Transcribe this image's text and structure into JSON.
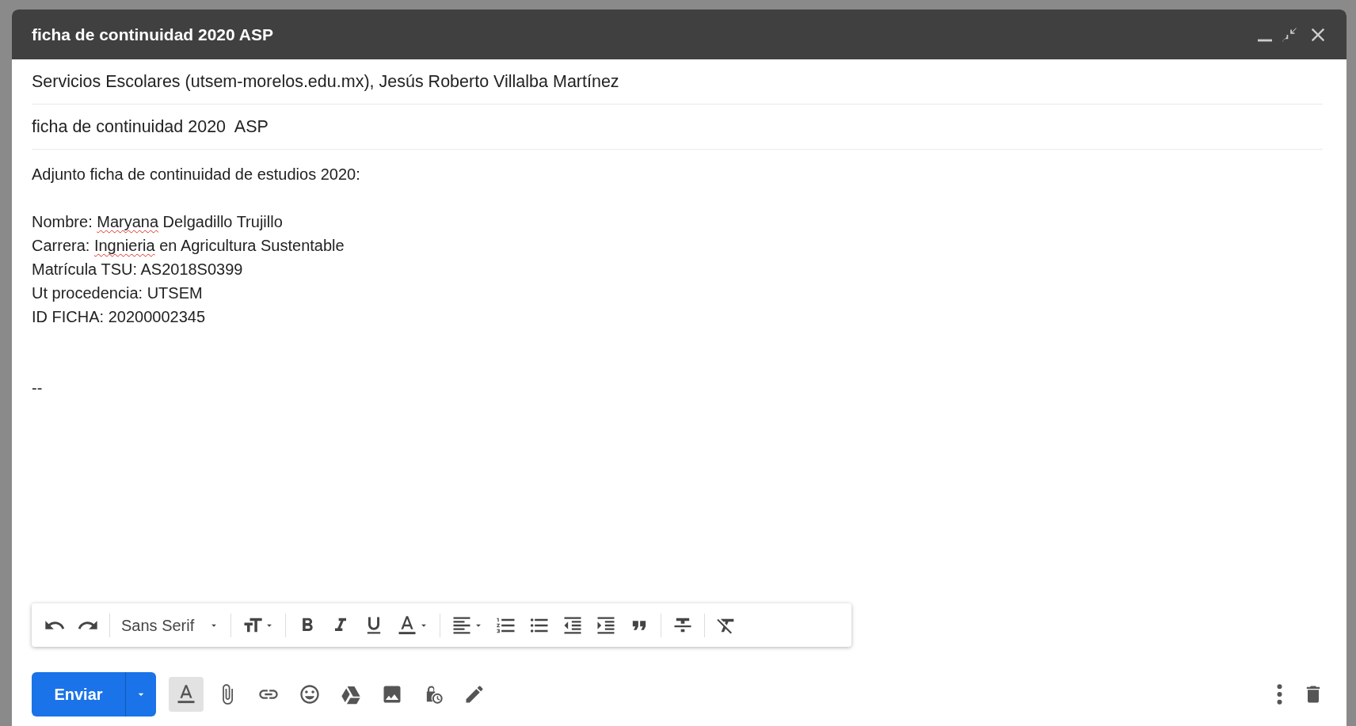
{
  "window": {
    "title": "ficha de continuidad 2020 ASP"
  },
  "recipients": "Servicios Escolares (utsem-morelos.edu.mx), Jesús Roberto Villalba Martínez",
  "subject": "ficha de continuidad 2020  ASP",
  "body": [
    {
      "kind": "text",
      "lines": [
        {
          "segments": [
            {
              "text": "Adjunto ficha de continuidad de estudios 2020:",
              "misspelled": false
            }
          ]
        }
      ]
    },
    {
      "kind": "text",
      "lines": [
        {
          "segments": [
            {
              "text": "Nombre: ",
              "misspelled": false
            },
            {
              "text": "Maryana",
              "misspelled": true
            },
            {
              "text": " Delgadillo Trujillo",
              "misspelled": false
            }
          ]
        },
        {
          "segments": [
            {
              "text": "Carrera: ",
              "misspelled": false
            },
            {
              "text": "Ingnieria",
              "misspelled": true
            },
            {
              "text": " en Agricultura Sustentable",
              "misspelled": false
            }
          ]
        },
        {
          "segments": [
            {
              "text": "Matrícula TSU: AS2018S0399",
              "misspelled": false
            }
          ]
        },
        {
          "segments": [
            {
              "text": "Ut procedencia: UTSEM",
              "misspelled": false
            }
          ]
        },
        {
          "segments": [
            {
              "text": "ID FICHA: 20200002345",
              "misspelled": false
            }
          ]
        }
      ]
    },
    {
      "kind": "signature",
      "lines": [
        {
          "segments": [
            {
              "text": "--",
              "misspelled": false
            }
          ]
        }
      ]
    }
  ],
  "format_toolbar": {
    "font": "Sans Serif"
  },
  "send_button": {
    "label": "Enviar"
  },
  "formatting_toggle": {
    "on": true
  }
}
